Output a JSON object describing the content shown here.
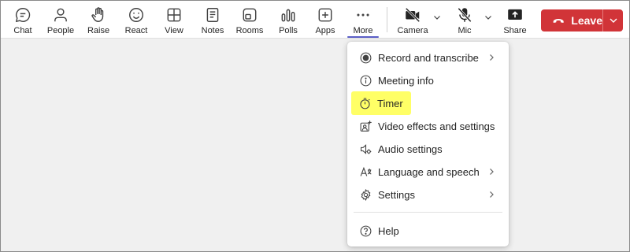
{
  "toolbar": {
    "buttons": [
      {
        "label": "Chat",
        "icon": "chat-icon"
      },
      {
        "label": "People",
        "icon": "people-icon"
      },
      {
        "label": "Raise",
        "icon": "hand-icon"
      },
      {
        "label": "React",
        "icon": "smiley-icon"
      },
      {
        "label": "View",
        "icon": "grid-icon"
      },
      {
        "label": "Notes",
        "icon": "notes-icon"
      },
      {
        "label": "Rooms",
        "icon": "rooms-icon"
      },
      {
        "label": "Polls",
        "icon": "polls-icon"
      },
      {
        "label": "Apps",
        "icon": "apps-plus-icon"
      },
      {
        "label": "More",
        "icon": "more-ellipsis-icon"
      },
      {
        "label": "Camera",
        "icon": "camera-off-icon"
      },
      {
        "label": "Mic",
        "icon": "mic-off-icon"
      },
      {
        "label": "Share",
        "icon": "share-tray-icon"
      }
    ],
    "leave_label": "Leave",
    "accent_color": "#5b5fc7",
    "leave_color": "#d13438"
  },
  "more_menu": {
    "items": [
      {
        "label": "Record and transcribe",
        "icon": "record-icon",
        "submenu": true
      },
      {
        "label": "Meeting info",
        "icon": "info-icon",
        "submenu": false
      },
      {
        "label": "Timer",
        "icon": "timer-icon",
        "submenu": false,
        "highlighted": true
      },
      {
        "label": "Video effects and settings",
        "icon": "video-effects-icon",
        "submenu": false
      },
      {
        "label": "Audio settings",
        "icon": "speaker-settings-icon",
        "submenu": false
      },
      {
        "label": "Language and speech",
        "icon": "language-icon",
        "submenu": true
      },
      {
        "label": "Settings",
        "icon": "gear-icon",
        "submenu": true
      },
      {
        "label": "Help",
        "icon": "help-icon",
        "submenu": false
      }
    ],
    "highlight_color": "#ffff66"
  }
}
